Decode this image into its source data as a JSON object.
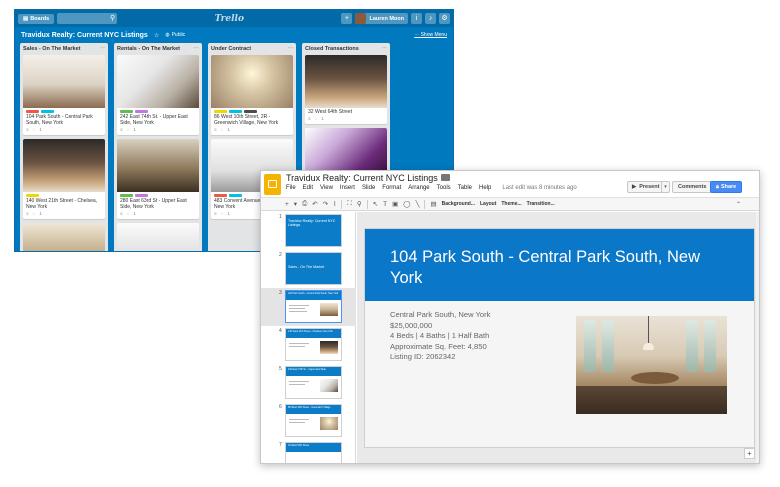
{
  "trello": {
    "boards_label": "Boards",
    "logo": "Trello",
    "user_name": "Lauren Moon",
    "board_title": "Travidux Realty: Current NYC Listings",
    "visibility": "Public",
    "show_menu": "Show Menu",
    "lists": [
      {
        "title": "Sales - On The Market",
        "cards": [
          {
            "title": "104 Park South - Central Park South, New York",
            "labels": [
              "#eb5a46",
              "#00c2e0"
            ],
            "badge_count": "1"
          },
          {
            "title": "140 West 21th Street - Chelsea, New York",
            "labels": [
              "#f2d600"
            ],
            "badge_count": "1"
          }
        ]
      },
      {
        "title": "Rentals - On The Market",
        "cards": [
          {
            "title": "242 East 74th St. - Upper East Side, New York",
            "labels": [
              "#61bd4f",
              "#c377e0"
            ],
            "badge_count": "1"
          },
          {
            "title": "280 East 63rd St - Upper East Side, New York",
            "labels": [
              "#61bd4f",
              "#c377e0"
            ],
            "badge_count": "1"
          }
        ]
      },
      {
        "title": "Under Contract",
        "cards": [
          {
            "title": "86 West 10th Street, 2R - Greenwich Village, New York",
            "labels": [
              "#f2d600",
              "#00c2e0",
              "#4d4d4d"
            ],
            "badge_count": "1"
          },
          {
            "title": "483 Convent Avenue - Heights, New York",
            "labels": [
              "#eb5a46",
              "#00c2e0"
            ],
            "badge_count": "1"
          }
        ]
      },
      {
        "title": "Closed Transactions",
        "cards": [
          {
            "title": "32 West 64th Street",
            "labels": [],
            "badge_count": "1"
          }
        ]
      }
    ]
  },
  "slides": {
    "doc_title": "Travidux Realty: Current NYC Listings",
    "menu": [
      "File",
      "Edit",
      "View",
      "Insert",
      "Slide",
      "Format",
      "Arrange",
      "Tools",
      "Table",
      "Help"
    ],
    "last_edit": "Last edit was 8 minutes ago",
    "present_label": "Present",
    "comments_label": "Comments",
    "share_label": "Share",
    "toolbar": {
      "background": "Background...",
      "layout": "Layout",
      "theme": "Theme...",
      "transition": "Transition..."
    },
    "thumbnails": [
      {
        "num": "1",
        "text": "Travidux Realty: Current NYC Listings"
      },
      {
        "num": "2",
        "text": "Sales - On The Market"
      },
      {
        "num": "3",
        "text": "104 Park South - Central Park South, New York"
      },
      {
        "num": "4",
        "text": "140 West 21th Street - Chelsea, New York"
      },
      {
        "num": "5",
        "text": "242 East 74th St. - Upper East Side"
      },
      {
        "num": "6",
        "text": "86 West 10th Street - Greenwich Village"
      },
      {
        "num": "7",
        "text": "32 West 64th Street"
      }
    ],
    "current_slide": {
      "title": "104 Park South - Central Park South, New York",
      "lines": [
        "Central Park South, New York",
        "$25,000,000",
        "4 Beds | 4 Baths | 1 Half Bath",
        "Approximate Sq. Feet: 4,850",
        "Listing ID: 2062342"
      ]
    }
  },
  "colors": {
    "trello_blue": "#0079bf",
    "slide_header_blue": "#0b77c8",
    "slides_logo_yellow": "#f4b400",
    "share_blue": "#4a8af4"
  }
}
